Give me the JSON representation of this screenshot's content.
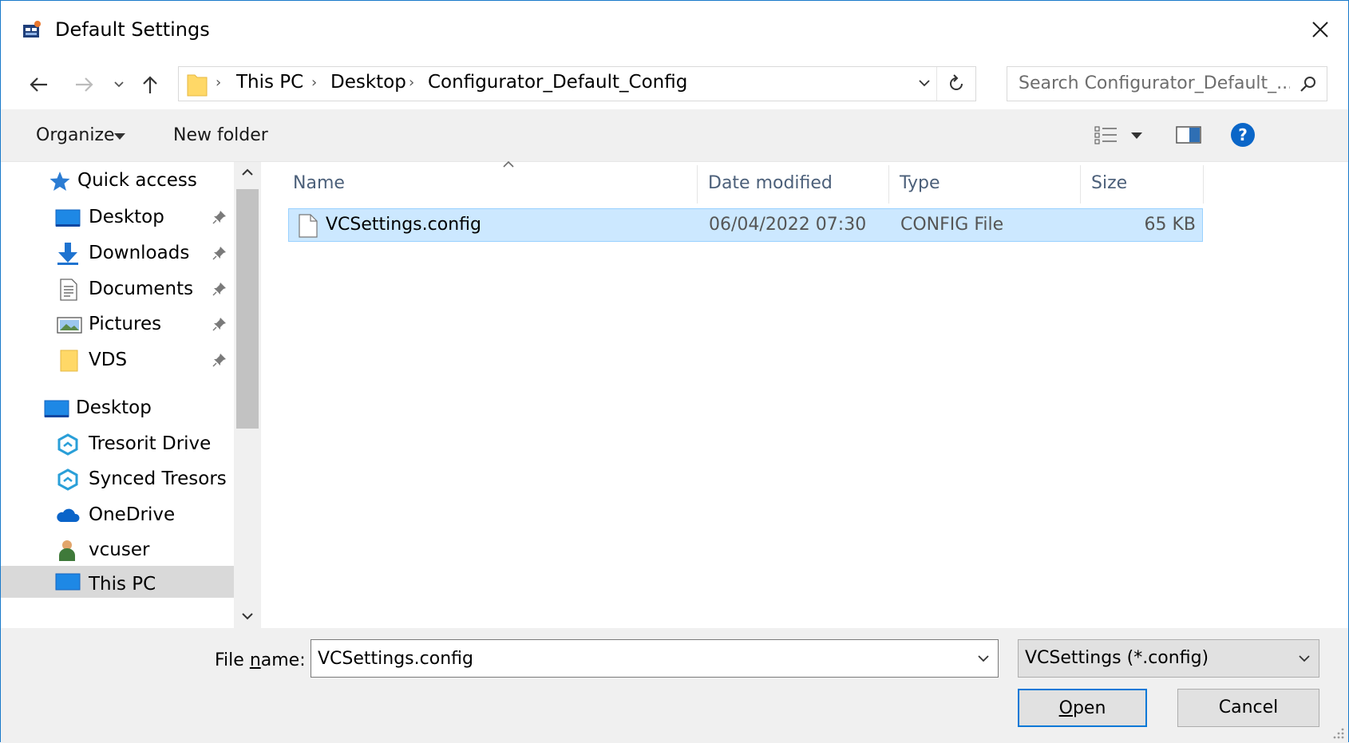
{
  "window": {
    "title": "Default Settings"
  },
  "address": {
    "crumbs": [
      "This PC",
      "Desktop",
      "Configurator_Default_Config"
    ]
  },
  "search": {
    "placeholder": "Search Configurator_Default_..."
  },
  "commandbar": {
    "organize": "Organize",
    "new_folder": "New folder"
  },
  "navpane": {
    "items": [
      {
        "label": "Quick access",
        "icon": "star-icon"
      },
      {
        "label": "Desktop",
        "icon": "desktop-icon",
        "pinned": true
      },
      {
        "label": "Downloads",
        "icon": "download-arrow-icon",
        "pinned": true
      },
      {
        "label": "Documents",
        "icon": "document-icon",
        "pinned": true
      },
      {
        "label": "Pictures",
        "icon": "pictures-icon",
        "pinned": true
      },
      {
        "label": "VDS",
        "icon": "folder-icon",
        "pinned": true
      },
      {
        "label": "Desktop",
        "icon": "desktop-icon"
      },
      {
        "label": "Tresorit Drive",
        "icon": "tresorit-icon"
      },
      {
        "label": "Synced Tresors",
        "icon": "tresorit-icon"
      },
      {
        "label": "OneDrive",
        "icon": "cloud-icon"
      },
      {
        "label": "vcuser",
        "icon": "user-icon"
      },
      {
        "label": "This PC",
        "icon": "computer-icon"
      }
    ]
  },
  "filelist": {
    "columns": [
      "Name",
      "Date modified",
      "Type",
      "Size"
    ],
    "rows": [
      {
        "name": "VCSettings.config",
        "date": "06/04/2022 07:30",
        "type": "CONFIG File",
        "size": "65 KB"
      }
    ]
  },
  "bottom": {
    "file_name_label": "File name:",
    "file_name_value": "VCSettings.config",
    "file_type": "VCSettings (*.config)",
    "open": "Open",
    "cancel": "Cancel"
  },
  "colors": {
    "accent": "#0078d7",
    "selection": "#cce8ff",
    "selection_border": "#99d1ff",
    "header_text": "#4c607a"
  }
}
